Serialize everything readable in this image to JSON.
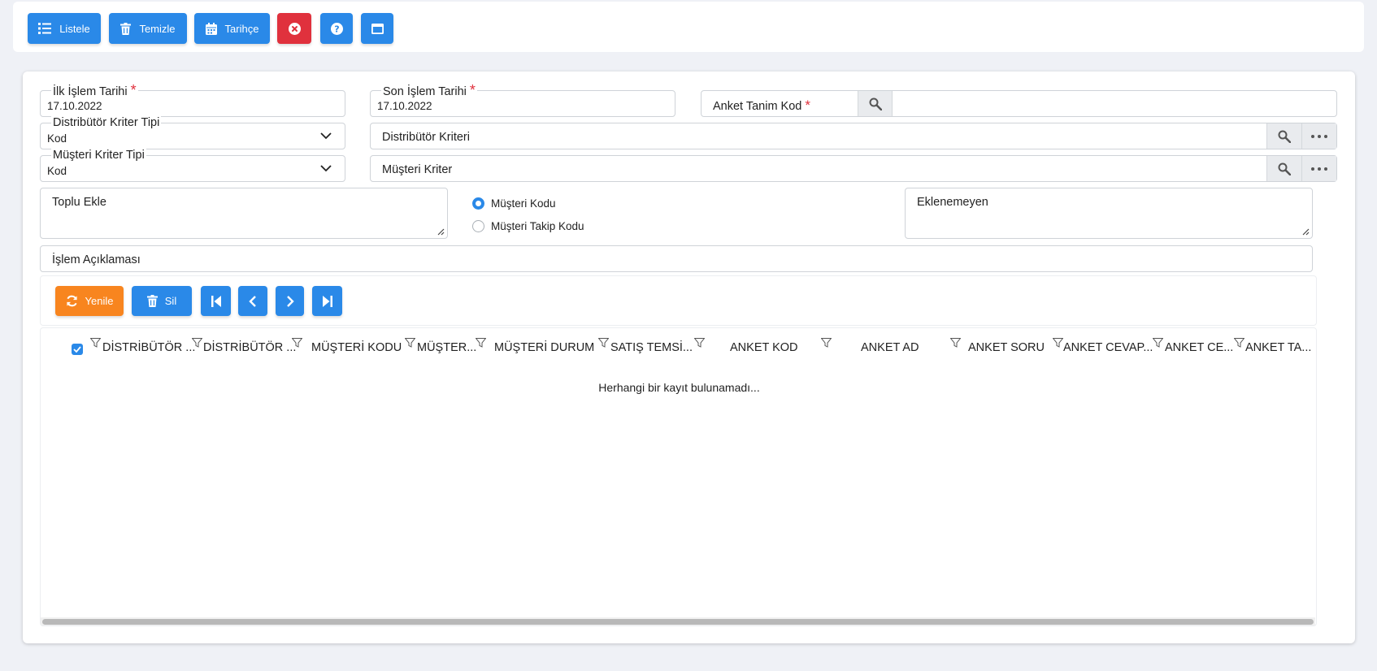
{
  "toolbar": {
    "list_label": "Listele",
    "clear_label": "Temizle",
    "history_label": "Tarihçe"
  },
  "form": {
    "first_date_label": "İlk İşlem Tarihi",
    "first_date_value": "17.10.2022",
    "last_date_label": "Son İşlem Tarihi",
    "last_date_value": "17.10.2022",
    "survey_code_label": "Anket Tanim Kod",
    "required_mark": "*",
    "dist_type_label": "Distribütör Kriter Tipi",
    "dist_type_value": "Kod",
    "dist_criteria_label": "Distribütör Kriteri",
    "cust_type_label": "Müşteri Kriter Tipi",
    "cust_type_value": "Kod",
    "cust_criteria_label": "Müşteri Kriter",
    "bulk_add_label": "Toplu Ekle",
    "radio_customer_code": "Müşteri Kodu",
    "radio_customer_tracking": "Müşteri Takip Kodu",
    "not_added_label": "Eklenemeyen",
    "description_label": "İşlem Açıklaması"
  },
  "grid_toolbar": {
    "refresh_label": "Yenile",
    "delete_label": "Sil"
  },
  "grid": {
    "columns": [
      "DİSTRİBÜTÖR ...",
      "DİSTRİBÜTÖR ...",
      "MÜŞTERİ KODU",
      "MÜŞTER...",
      "MÜŞTERİ DURUM",
      "SATIŞ TEMSİ...",
      "ANKET KOD",
      "ANKET AD",
      "ANKET SORU",
      "ANKET CEVAP...",
      "ANKET CE...",
      "ANKET TA..."
    ],
    "empty_message": "Herhangi bir kayıt bulunamadı..."
  },
  "colors": {
    "primary": "#2a89e8",
    "danger": "#e0313d",
    "warning": "#f8851f"
  }
}
